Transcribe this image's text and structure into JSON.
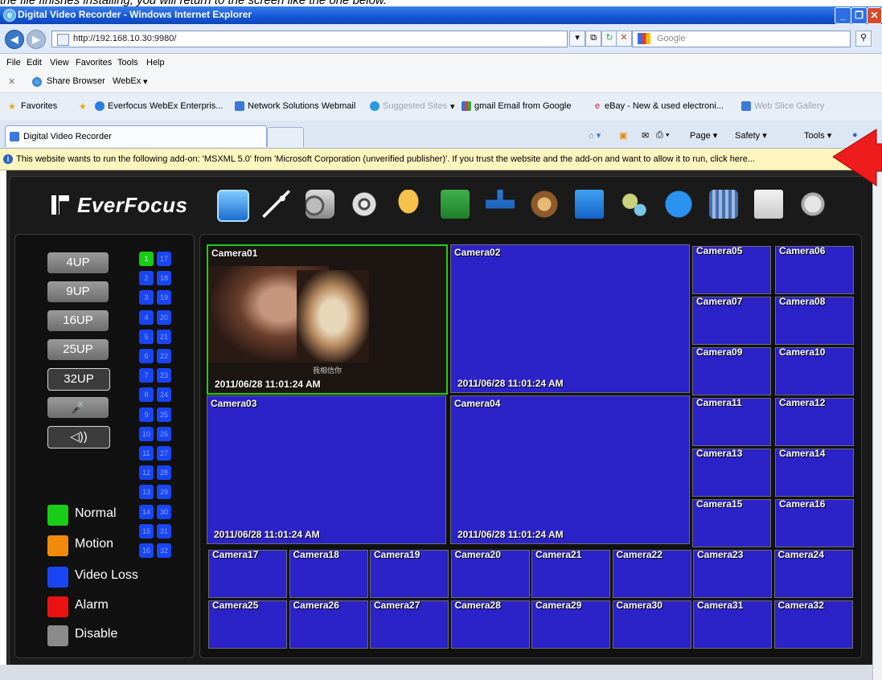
{
  "caption": "the file finishes installing, you will return to the screen like the one below.",
  "window": {
    "title": "Digital Video Recorder - Windows Internet Explorer"
  },
  "address": {
    "url": "http://192.168.10.30:9980/",
    "search_placeholder": "Google"
  },
  "menu": [
    "File",
    "Edit",
    "View",
    "Favorites",
    "Tools",
    "Help"
  ],
  "webex": {
    "share": "Share Browser",
    "webex": "WebEx"
  },
  "favorites": {
    "label": "Favorites",
    "items": [
      "Everfocus WebEx Enterpris...",
      "Network Solutions Webmail",
      "Suggested Sites",
      "gmail Email from Google",
      "eBay - New & used electroni...",
      "Web Slice Gallery"
    ]
  },
  "tab": {
    "title": "Digital Video Recorder",
    "cmds": [
      "Page",
      "Safety",
      "Tools"
    ]
  },
  "infobar": "This website wants to run the following add-on: 'MSXML 5.0' from 'Microsoft Corporation (unverified publisher)'. If you trust the website and the add-on and want to allow it to run, click here...",
  "dvr": {
    "brand": "EverFocus",
    "toolbar_icons": [
      "monitor-icon",
      "wand-icon",
      "camera-icon",
      "film-reel-icon",
      "bell-icon",
      "schedule-icon",
      "network-icon",
      "hdd-icon",
      "display-icon",
      "gears-icon",
      "info-icon",
      "film-icon",
      "search-doc-icon",
      "mouse-icon"
    ],
    "layouts": [
      "4UP",
      "9UP",
      "16UP",
      "25UP",
      "32UP"
    ],
    "active_layout": "32UP",
    "channels_left": [
      "1",
      "2",
      "3",
      "4",
      "5",
      "6",
      "7",
      "8",
      "9",
      "10",
      "11",
      "12",
      "13",
      "14",
      "15",
      "16"
    ],
    "channels_right": [
      "17",
      "18",
      "19",
      "20",
      "21",
      "22",
      "23",
      "24",
      "25",
      "26",
      "27",
      "28",
      "29",
      "30",
      "31",
      "32"
    ],
    "legend": [
      {
        "label": "Normal",
        "color": "#19cc17"
      },
      {
        "label": "Motion",
        "color": "#f08a0c"
      },
      {
        "label": "Video Loss",
        "color": "#1a45f2"
      },
      {
        "label": "Alarm",
        "color": "#ea1212"
      },
      {
        "label": "Disable",
        "color": "#8a8a8a"
      }
    ],
    "timestamp": "2011/06/28  11:01:24 AM",
    "cameras": [
      "Camera01",
      "Camera02",
      "Camera03",
      "Camera04",
      "Camera05",
      "Camera06",
      "Camera07",
      "Camera08",
      "Camera09",
      "Camera10",
      "Camera11",
      "Camera12",
      "Camera13",
      "Camera14",
      "Camera15",
      "Camera16",
      "Camera17",
      "Camera18",
      "Camera19",
      "Camera20",
      "Camera21",
      "Camera22",
      "Camera23",
      "Camera24",
      "Camera25",
      "Camera26",
      "Camera27",
      "Camera28",
      "Camera29",
      "Camera30",
      "Camera31",
      "Camera32"
    ],
    "overlay_subtitle": "我相信你"
  }
}
